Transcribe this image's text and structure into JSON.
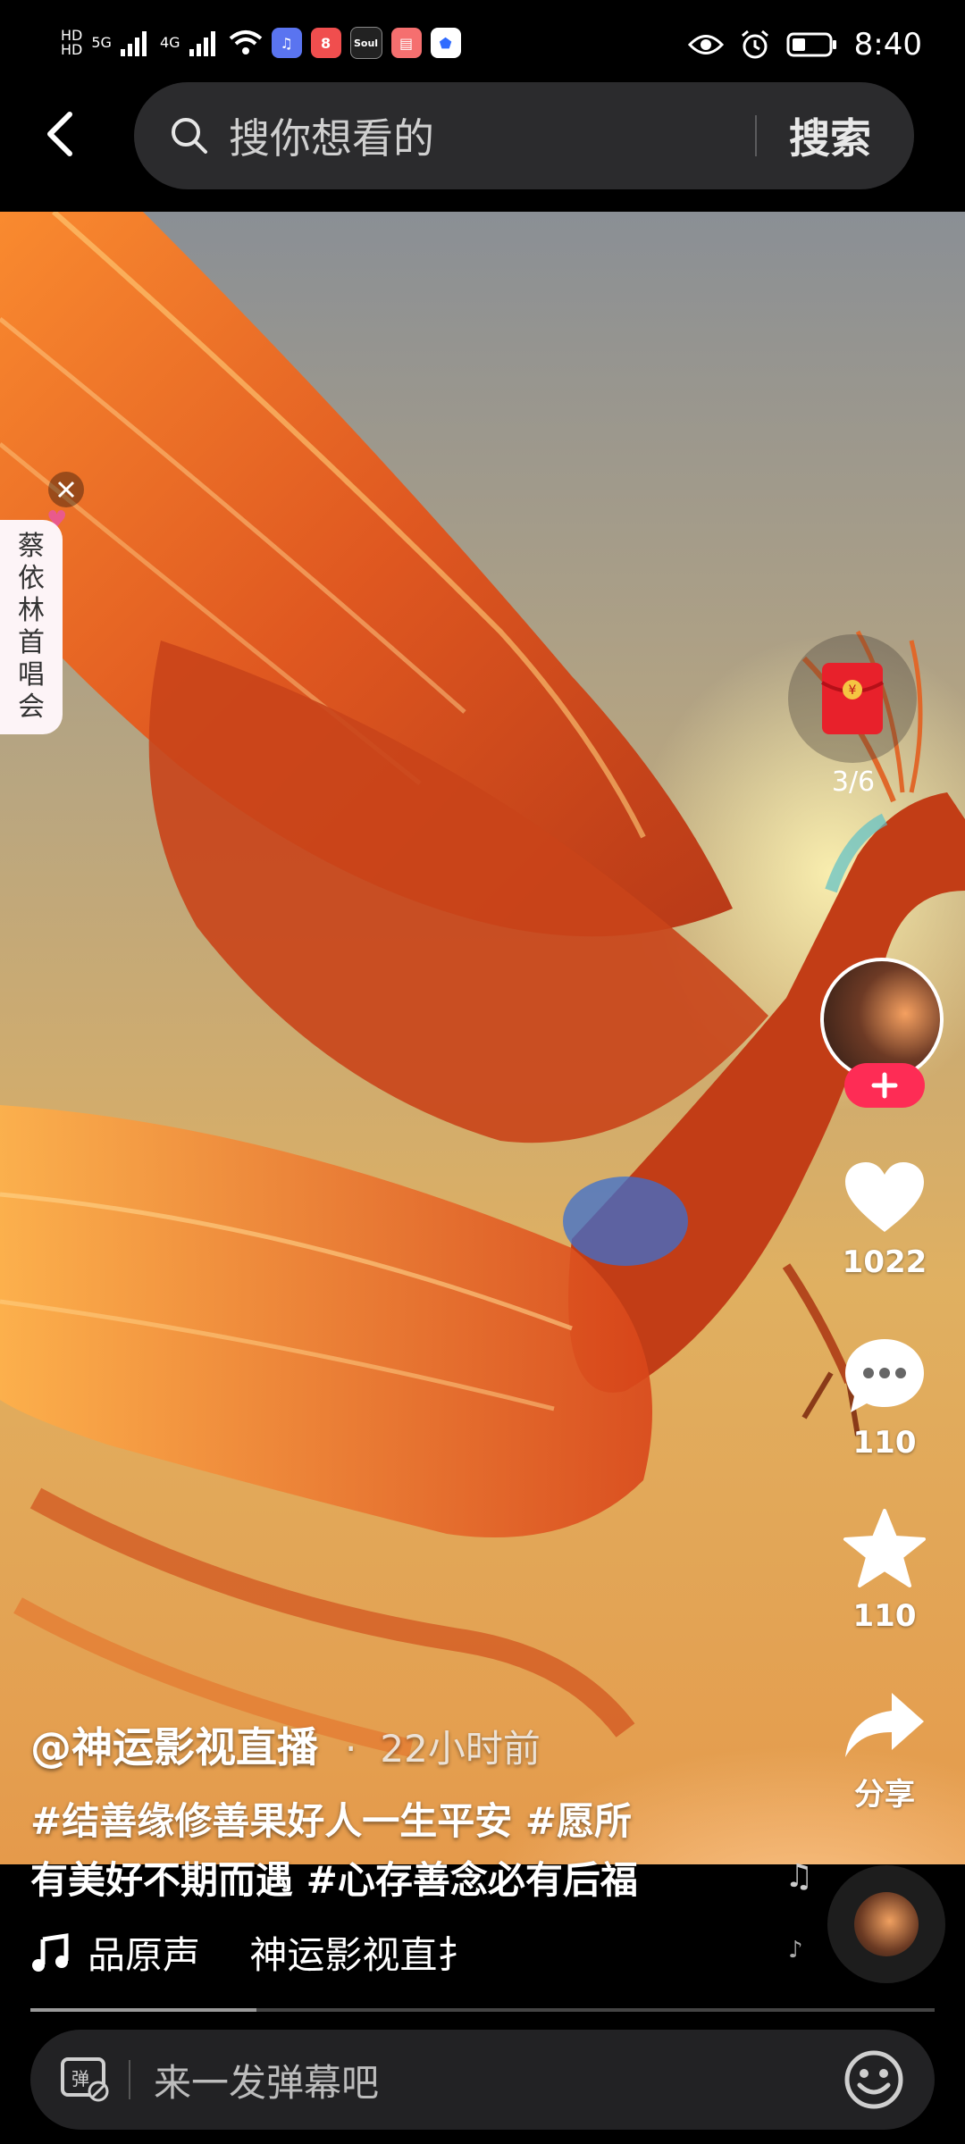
{
  "status_bar": {
    "time": "8:40",
    "network_1": "5G",
    "network_2": "4G",
    "hd_1": "HD",
    "hd_2": "HD",
    "app_soul": "Soul"
  },
  "search": {
    "placeholder": "搜你想看的",
    "button_label": "搜索"
  },
  "side_tag": {
    "label": "蔡依林首唱会"
  },
  "right_rail": {
    "red_packet_progress": "3/6",
    "likes": "1022",
    "comments": "110",
    "favorites": "110",
    "share_label": "分享"
  },
  "post": {
    "author": "@神运影视直播",
    "time_ago": "22小时前",
    "desc_line1": "#结善缘修善果好人一生平安 #愿所",
    "desc_line2": "有美好不期而遇 #心存善念必有后福",
    "music_text": "品原声　 神运影视直扌"
  },
  "progress": {
    "fraction": 0.25
  },
  "danmu": {
    "placeholder": "来一发弹幕吧"
  },
  "colors": {
    "accent": "#fe2c55",
    "search_bg": "#2b2b2d"
  }
}
